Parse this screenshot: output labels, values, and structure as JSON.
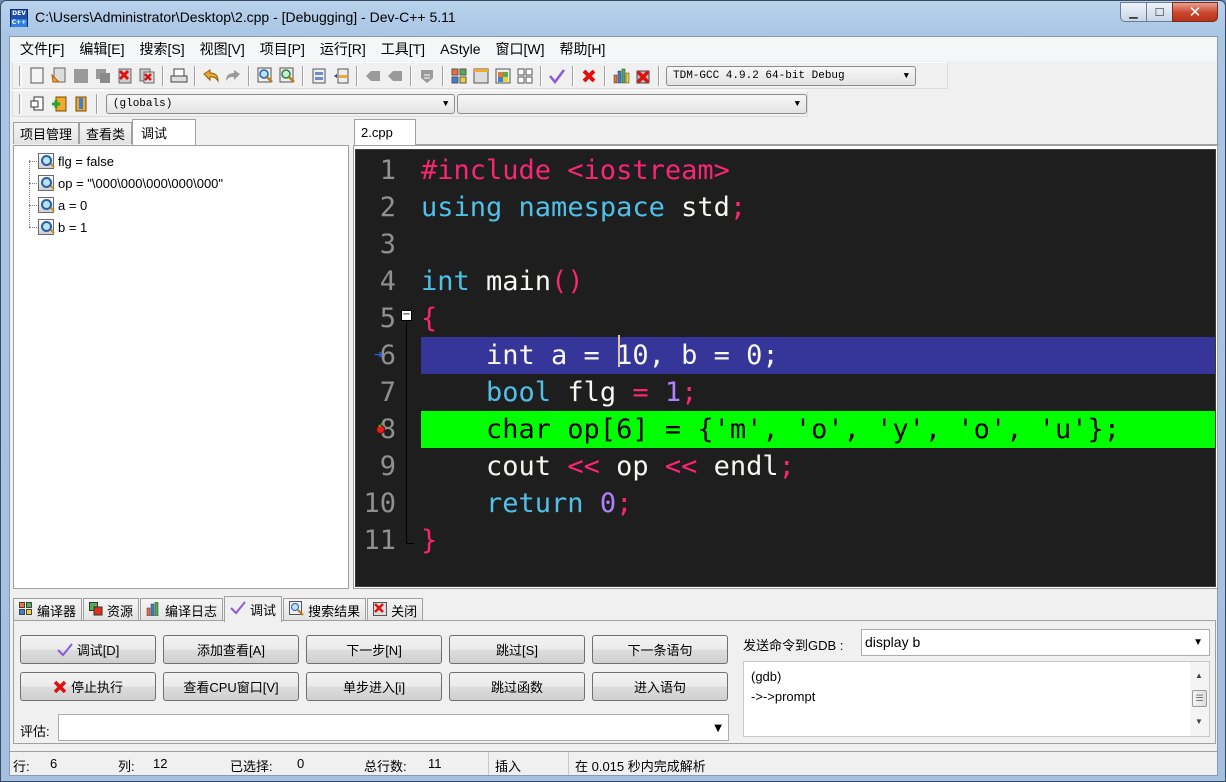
{
  "window": {
    "title": "C:\\Users\\Administrator\\Desktop\\2.cpp - [Debugging] - Dev-C++ 5.11",
    "icon_text_top": "DEV",
    "icon_text_bottom": "C++",
    "minimize": "▁",
    "maximize": "☐",
    "close": "✕"
  },
  "menu": [
    "文件[F]",
    "编辑[E]",
    "搜索[S]",
    "视图[V]",
    "项目[P]",
    "运行[R]",
    "工具[T]",
    "AStyle",
    "窗口[W]",
    "帮助[H]"
  ],
  "toolbar": {
    "compiler_select": "TDM-GCC 4.9.2 64-bit Debug",
    "scope_select": "(globals)",
    "symbol_select": ""
  },
  "left_tabs": [
    "项目管理",
    "查看类",
    "调试"
  ],
  "watches": [
    {
      "label": "flg = false"
    },
    {
      "label": "op = \"\\000\\000\\000\\000\\000\""
    },
    {
      "label": "a = 0"
    },
    {
      "label": "b = 1"
    }
  ],
  "editor": {
    "tab": "2.cpp",
    "lines": [
      {
        "n": "1",
        "tokens": [
          [
            "pp",
            "#include <iostream>"
          ]
        ]
      },
      {
        "n": "2",
        "tokens": [
          [
            "kw",
            "using"
          ],
          [
            "pl",
            " "
          ],
          [
            "kw",
            "namespace"
          ],
          [
            "pl",
            " std"
          ],
          [
            "pn",
            ";"
          ]
        ]
      },
      {
        "n": "3",
        "tokens": []
      },
      {
        "n": "4",
        "tokens": [
          [
            "kw",
            "int"
          ],
          [
            "pl",
            " main"
          ],
          [
            "pn",
            "()"
          ]
        ]
      },
      {
        "n": "5",
        "tokens": [
          [
            "pn",
            "{"
          ]
        ]
      },
      {
        "n": "6",
        "tokens": [
          [
            "pl",
            "    int a = 10, b = 0;"
          ]
        ],
        "state": "exec"
      },
      {
        "n": "7",
        "tokens": [
          [
            "pl",
            "    "
          ],
          [
            "kw",
            "bool"
          ],
          [
            "pl",
            " flg "
          ],
          [
            "op",
            "="
          ],
          [
            "pl",
            " "
          ],
          [
            "num",
            "1"
          ],
          [
            "pn",
            ";"
          ]
        ]
      },
      {
        "n": "8",
        "tokens": [
          [
            "bp",
            "    char op[6] = {'m', 'o', 'y', 'o', 'u'};"
          ]
        ],
        "state": "breakpoint"
      },
      {
        "n": "9",
        "tokens": [
          [
            "pl",
            "    cout "
          ],
          [
            "op",
            "<<"
          ],
          [
            "pl",
            " op "
          ],
          [
            "op",
            "<<"
          ],
          [
            "pl",
            " endl"
          ],
          [
            "pn",
            ";"
          ]
        ]
      },
      {
        "n": "10",
        "tokens": [
          [
            "pl",
            "    "
          ],
          [
            "kw",
            "return"
          ],
          [
            "pl",
            " "
          ],
          [
            "num",
            "0"
          ],
          [
            "pn",
            ";"
          ]
        ]
      },
      {
        "n": "11",
        "tokens": [
          [
            "pn",
            "}"
          ]
        ]
      }
    ],
    "colors": {
      "exec_line": "#36369a",
      "breakpoint_line": "#00ff00",
      "background": "#1e1e1e"
    }
  },
  "bottom_tabs": [
    {
      "label": "编译器",
      "icon": "grid-icon"
    },
    {
      "label": "资源",
      "icon": "resources-icon"
    },
    {
      "label": "编译日志",
      "icon": "chart-icon"
    },
    {
      "label": "调试",
      "icon": "check-icon",
      "active": true
    },
    {
      "label": "搜索结果",
      "icon": "search-icon"
    },
    {
      "label": "关闭",
      "icon": "close-icon"
    }
  ],
  "debug_buttons": {
    "row1": [
      "调试[D]",
      "添加查看[A]",
      "下一步[N]",
      "跳过[S]",
      "下一条语句"
    ],
    "row2": [
      "停止执行",
      "查看CPU窗口[V]",
      "单步进入[i]",
      "跳过函数",
      "进入语句"
    ]
  },
  "gdb": {
    "label": "发送命令到GDB :",
    "command": "display b",
    "output": [
      "(gdb)",
      "->->prompt"
    ]
  },
  "evaluate": {
    "label": "评估:",
    "value": ""
  },
  "status": {
    "row_label": "行:",
    "row": "6",
    "col_label": "列:",
    "col": "12",
    "sel_label": "已选择:",
    "sel": "0",
    "total_label": "总行数:",
    "total": "11",
    "mode": "插入",
    "parse": "在 0.015 秒内完成解析"
  }
}
